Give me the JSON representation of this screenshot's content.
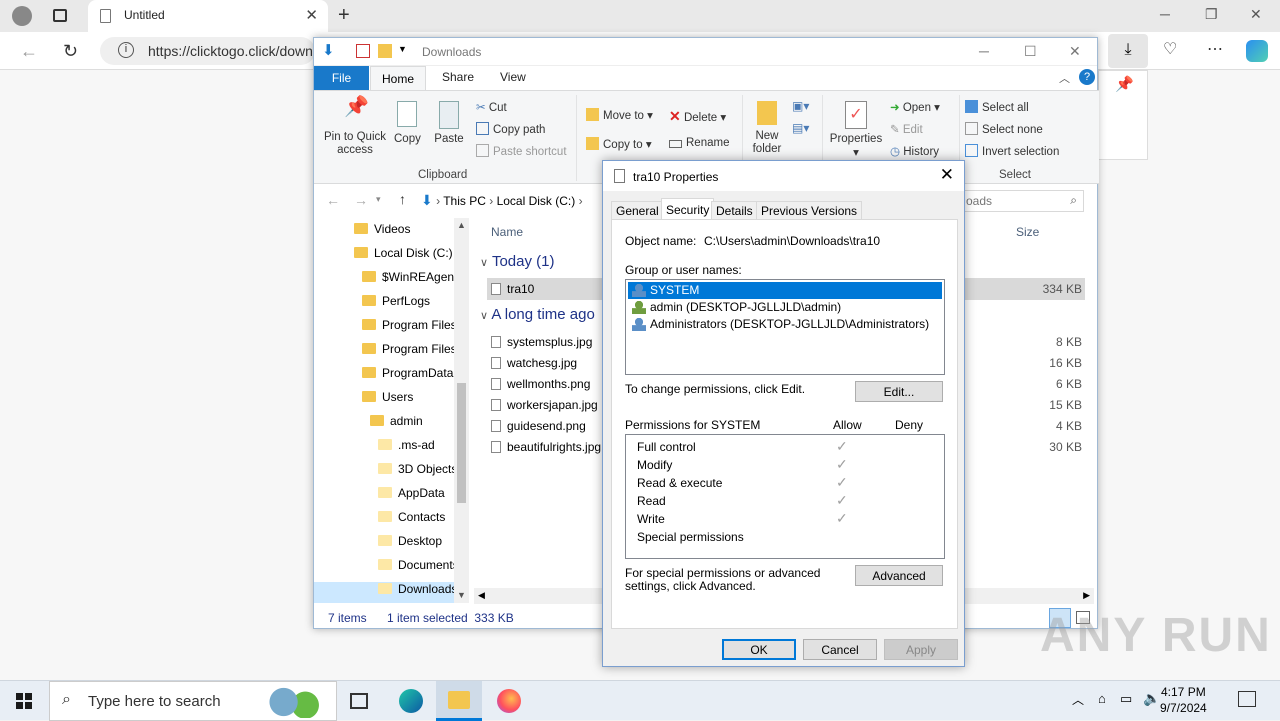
{
  "browser": {
    "tab_title": "Untitled",
    "url": "https://clicktogo.click/down"
  },
  "explorer": {
    "title": "Downloads",
    "ribbon_tabs": [
      "File",
      "Home",
      "Share",
      "View"
    ],
    "clipboard": {
      "pin": "Pin to Quick access",
      "copy": "Copy",
      "paste": "Paste",
      "cut": "Cut",
      "copy_path": "Copy path",
      "paste_shortcut": "Paste shortcut",
      "group": "Clipboard"
    },
    "organize": {
      "move_to": "Move to",
      "copy_to": "Copy to",
      "delete": "Delete",
      "rename": "Rename",
      "new_folder": "New folder"
    },
    "open": {
      "properties": "Properties",
      "open": "Open",
      "edit": "Edit",
      "history": "History"
    },
    "select": {
      "select_all": "Select all",
      "select_none": "Select none",
      "invert": "Invert selection",
      "group": "Select"
    },
    "breadcrumb": [
      "This PC",
      "Local Disk (C:)"
    ],
    "search_placeholder": "oads",
    "tree": [
      {
        "label": "Videos",
        "indent": 1
      },
      {
        "label": "Local Disk (C:)",
        "indent": 1
      },
      {
        "label": "$WinREAgent",
        "indent": 2
      },
      {
        "label": "PerfLogs",
        "indent": 2
      },
      {
        "label": "Program Files",
        "indent": 2
      },
      {
        "label": "Program Files",
        "indent": 2
      },
      {
        "label": "ProgramData",
        "indent": 2
      },
      {
        "label": "Users",
        "indent": 2
      },
      {
        "label": "admin",
        "indent": 3
      },
      {
        "label": ".ms-ad",
        "indent": 4
      },
      {
        "label": "3D Objects",
        "indent": 4
      },
      {
        "label": "AppData",
        "indent": 4
      },
      {
        "label": "Contacts",
        "indent": 4
      },
      {
        "label": "Desktop",
        "indent": 4
      },
      {
        "label": "Documents",
        "indent": 4
      },
      {
        "label": "Downloads",
        "indent": 4
      }
    ],
    "columns": {
      "name": "Name",
      "size": "Size"
    },
    "group_today": "Today (1)",
    "group_longago": "A long time ago",
    "files_today": [
      {
        "name": "tra10",
        "size": "334 KB"
      }
    ],
    "files_old": [
      {
        "name": "systemsplus.jpg",
        "size": "8 KB"
      },
      {
        "name": "watchesg.jpg",
        "size": "16 KB"
      },
      {
        "name": "wellmonths.png",
        "size": "6 KB"
      },
      {
        "name": "workersjapan.jpg",
        "size": "15 KB"
      },
      {
        "name": "guidesend.png",
        "size": "4 KB"
      },
      {
        "name": "beautifulrights.jpg",
        "size": "30 KB"
      }
    ],
    "status": {
      "items": "7 items",
      "selected": "1 item selected  333 KB"
    }
  },
  "props": {
    "title": "tra10 Properties",
    "tabs": [
      "General",
      "Security",
      "Details",
      "Previous Versions"
    ],
    "object_label": "Object name:",
    "object_value": "C:\\Users\\admin\\Downloads\\tra10",
    "group_label": "Group or user names:",
    "users": [
      "SYSTEM",
      "admin (DESKTOP-JGLLJLD\\admin)",
      "Administrators (DESKTOP-JGLLJLD\\Administrators)"
    ],
    "change_text": "To change permissions, click Edit.",
    "edit_btn": "Edit...",
    "perms_label": "Permissions for SYSTEM",
    "allow": "Allow",
    "deny": "Deny",
    "permissions": [
      "Full control",
      "Modify",
      "Read & execute",
      "Read",
      "Write",
      "Special permissions"
    ],
    "advanced_text": "For special permissions or advanced settings, click Advanced.",
    "advanced_btn": "Advanced",
    "ok": "OK",
    "cancel": "Cancel",
    "apply": "Apply"
  },
  "taskbar": {
    "search_placeholder": "Type here to search",
    "time": "4:17 PM",
    "date": "9/7/2024"
  },
  "watermark": "ANY RUN"
}
